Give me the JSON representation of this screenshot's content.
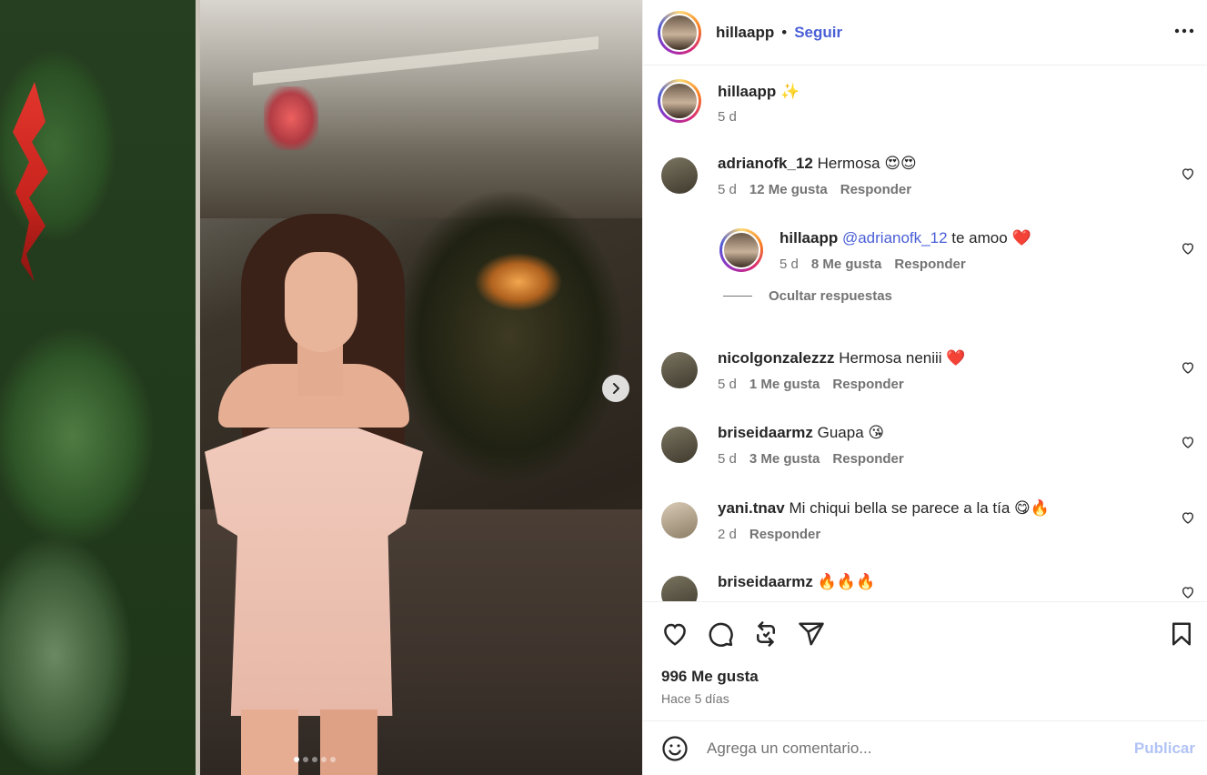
{
  "post": {
    "username": "hillaapp",
    "follow_label": "Seguir",
    "separator": "•",
    "caption_emoji": "✨",
    "caption_time": "5 d",
    "carousel": {
      "count": 5,
      "active": 1
    }
  },
  "comments": [
    {
      "user": "adrianofk_12",
      "text": "Hermosa",
      "emoji": "😍😍",
      "time": "5 d",
      "likes": "12 Me gusta",
      "reply": "Responder"
    },
    {
      "user": "hillaapp",
      "mention": "@adrianofk_12",
      "text": "te amoo",
      "emoji": "❤️",
      "time": "5 d",
      "likes": "8 Me gusta",
      "reply": "Responder"
    },
    {
      "user": "nicolgonzalezzz",
      "text": "Hermosa neniii",
      "emoji": "❤️",
      "time": "5 d",
      "likes": "1 Me gusta",
      "reply": "Responder"
    },
    {
      "user": "briseidaarmz",
      "text": "Guapa",
      "emoji": "😘",
      "time": "5 d",
      "likes": "3 Me gusta",
      "reply": "Responder"
    },
    {
      "user": "yani.tnav",
      "text": "Mi chiqui bella se parece a la tía",
      "emoji": "😋🔥",
      "time": "2 d",
      "reply": "Responder"
    },
    {
      "user": "briseidaarmz",
      "text": "",
      "emoji": "🔥🔥🔥"
    }
  ],
  "hide_replies_label": "Ocultar respuestas",
  "actions": {
    "icons": [
      "heart-icon",
      "comment-icon",
      "repost-icon",
      "share-icon",
      "save-icon"
    ],
    "likes_label": "996 Me gusta",
    "posted_ago": "Hace 5 días"
  },
  "composer": {
    "placeholder": "Agrega un comentario...",
    "publish_label": "Publicar",
    "publish_color": "#b2c3f5"
  },
  "colors": {
    "link": "#4a5fd6",
    "muted": "#737373",
    "text": "#262626"
  }
}
